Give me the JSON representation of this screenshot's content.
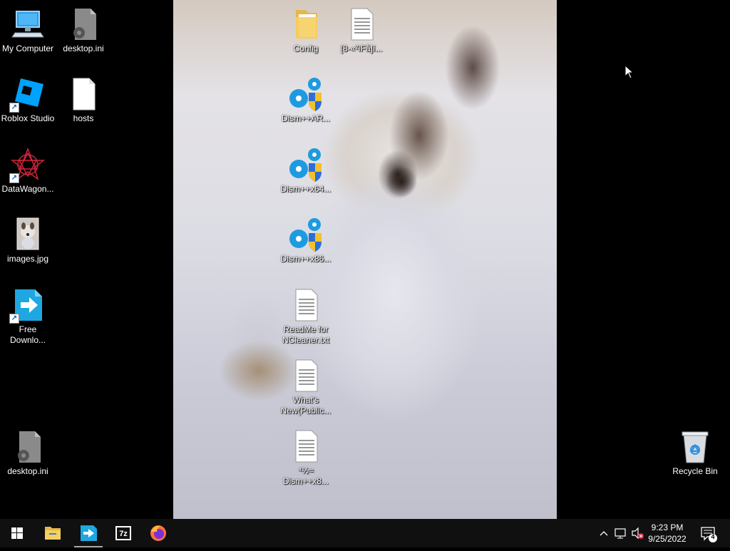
{
  "desktop": {
    "icons": [
      {
        "label": "My Computer"
      },
      {
        "label": "desktop.ini"
      },
      {
        "label": "Roblox Studio"
      },
      {
        "label": "hosts"
      },
      {
        "label": "DataWagon..."
      },
      {
        "label": "images.jpg"
      },
      {
        "label": "Free Downlo..."
      },
      {
        "label": "desktop.ini"
      },
      {
        "label": "Config"
      },
      {
        "label": "[8-«²ìFå]î..."
      },
      {
        "label": "Dism++AR..."
      },
      {
        "label": "Dism++x64..."
      },
      {
        "label": "Dism++x86..."
      },
      {
        "label": "ReadMe for NCleaner.txt"
      },
      {
        "label": "What's New(Public..."
      },
      {
        "label": "⁴½≈ Dism++x8..."
      },
      {
        "label": "Recycle Bin"
      }
    ]
  },
  "taskbar": {
    "pinned": [
      "windows-start",
      "file-explorer",
      "free-download-manager",
      "7-zip",
      "firefox"
    ],
    "clock_time": "9:23 PM",
    "clock_date": "9/25/2022",
    "notification_count": "4"
  },
  "colors": {
    "accent_blue": "#1e9be0",
    "taskbar": "#101010"
  }
}
